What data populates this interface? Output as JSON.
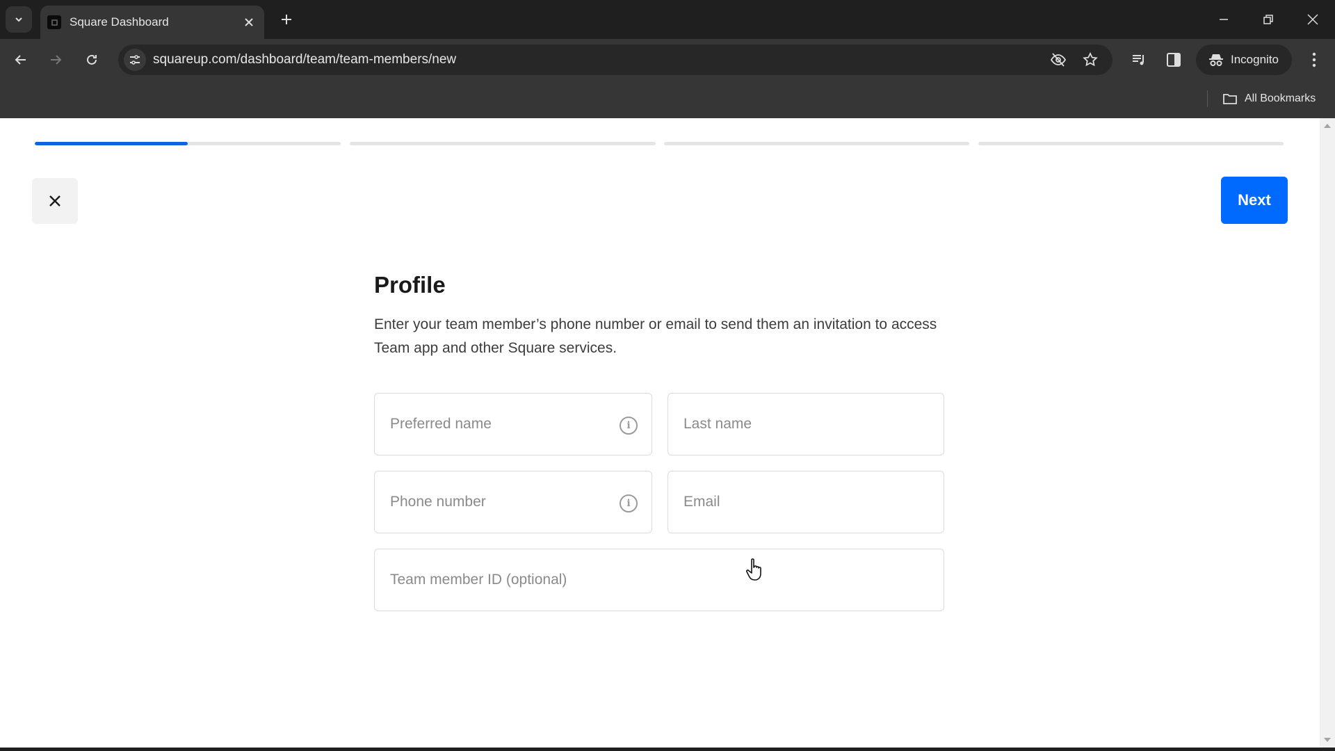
{
  "browser": {
    "tab_title": "Square Dashboard",
    "url": "squareup.com/dashboard/team/team-members/new",
    "incognito_label": "Incognito",
    "all_bookmarks_label": "All Bookmarks"
  },
  "wizard": {
    "total_steps": 4,
    "current_step": 1,
    "step_progress": [
      0.5,
      0,
      0,
      0
    ],
    "progress_color": "#0f63e0",
    "close_label": "Close",
    "next_label": "Next",
    "next_color": "#006aff"
  },
  "profile": {
    "heading": "Profile",
    "description": "Enter your team member’s phone number or email to send them an invitation to access Team app and other Square services.",
    "fields": {
      "preferred_name": {
        "placeholder": "Preferred name",
        "value": "",
        "has_info_icon": true
      },
      "last_name": {
        "placeholder": "Last name",
        "value": ""
      },
      "phone_number": {
        "placeholder": "Phone number",
        "value": "",
        "has_info_icon": true
      },
      "email": {
        "placeholder": "Email",
        "value": ""
      },
      "team_member_id": {
        "placeholder": "Team member ID (optional)",
        "value": ""
      }
    }
  }
}
